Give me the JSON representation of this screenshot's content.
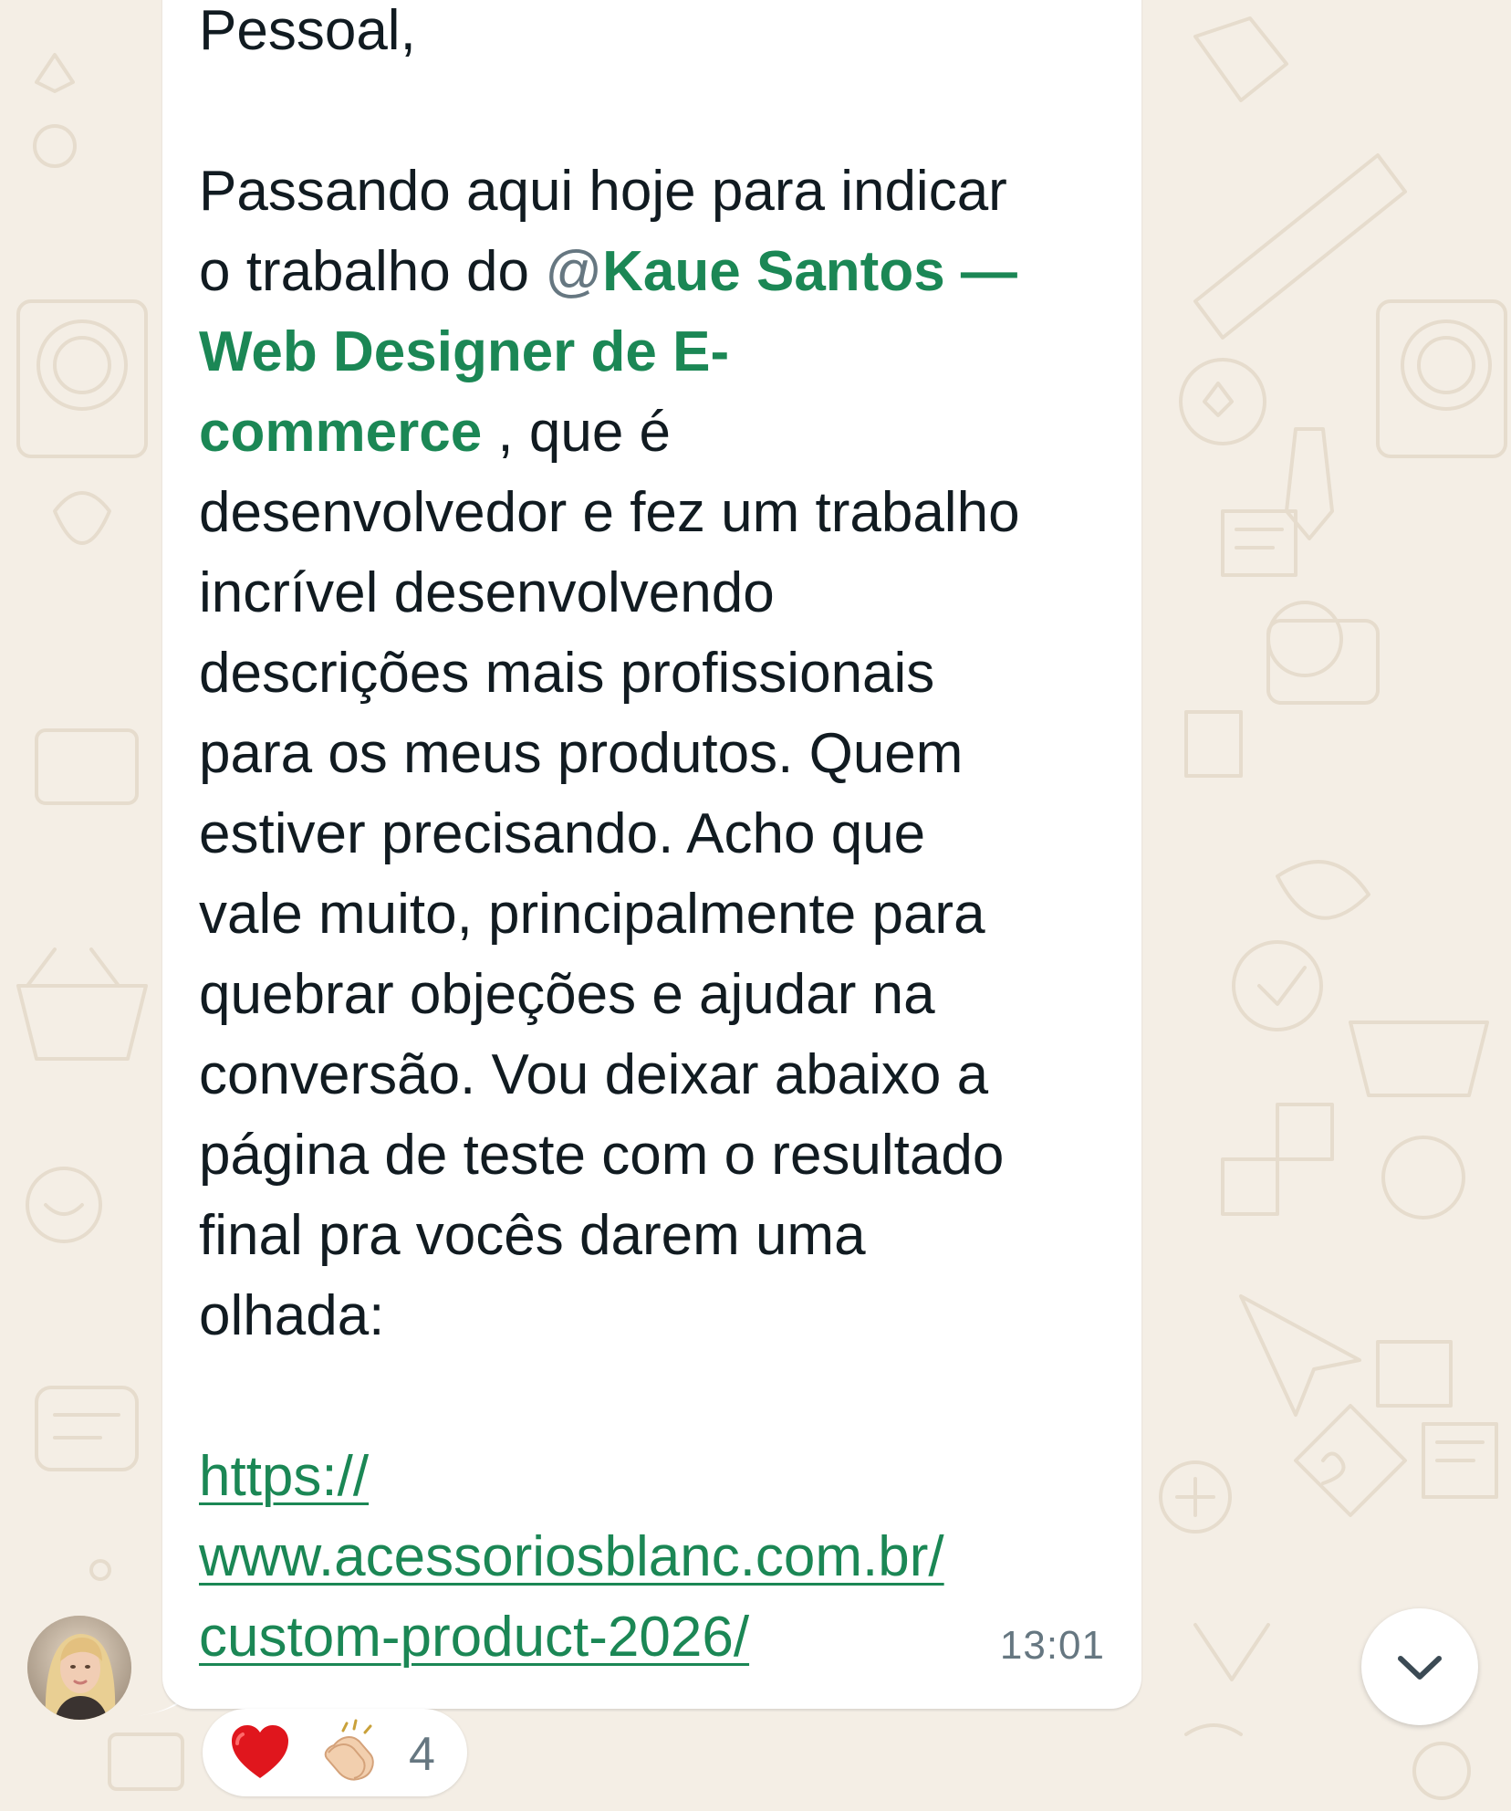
{
  "message": {
    "greeting": "Pessoal,",
    "body_lines": [
      "Passando aqui hoje para indicar",
      "o trabalho do "
    ],
    "mention_at": "@",
    "mention_name_part1": "Kaue Santos —",
    "mention_name_part2": "Web Designer de E-",
    "mention_name_part3": "commerce",
    "after_mention": " , que é",
    "lines": [
      "desenvolvedor e fez um trabalho",
      "incrível desenvolvendo",
      "descrições mais profissionais",
      "para os meus produtos. Quem",
      "estiver precisando. Acho que",
      "vale muito, principalmente para",
      "quebrar objeções e ajudar na",
      "conversão. Vou deixar abaixo a",
      "página de teste com o resultado",
      "final pra vocês darem uma",
      "olhada:"
    ],
    "link_lines": [
      "https://",
      "www.acessoriosblanc.com.br/",
      "custom-product-2026/"
    ],
    "time": "13:01"
  },
  "reactions": {
    "emojis": [
      "heart",
      "clapping-hands"
    ],
    "count": "4"
  },
  "scroll_button": {
    "icon": "chevron-down-icon"
  },
  "colors": {
    "wallpaper": "#f4eee5",
    "bubble": "#ffffff",
    "text": "#111b21",
    "mention": "#1b8755",
    "link": "#1b8755",
    "meta": "#667781"
  }
}
